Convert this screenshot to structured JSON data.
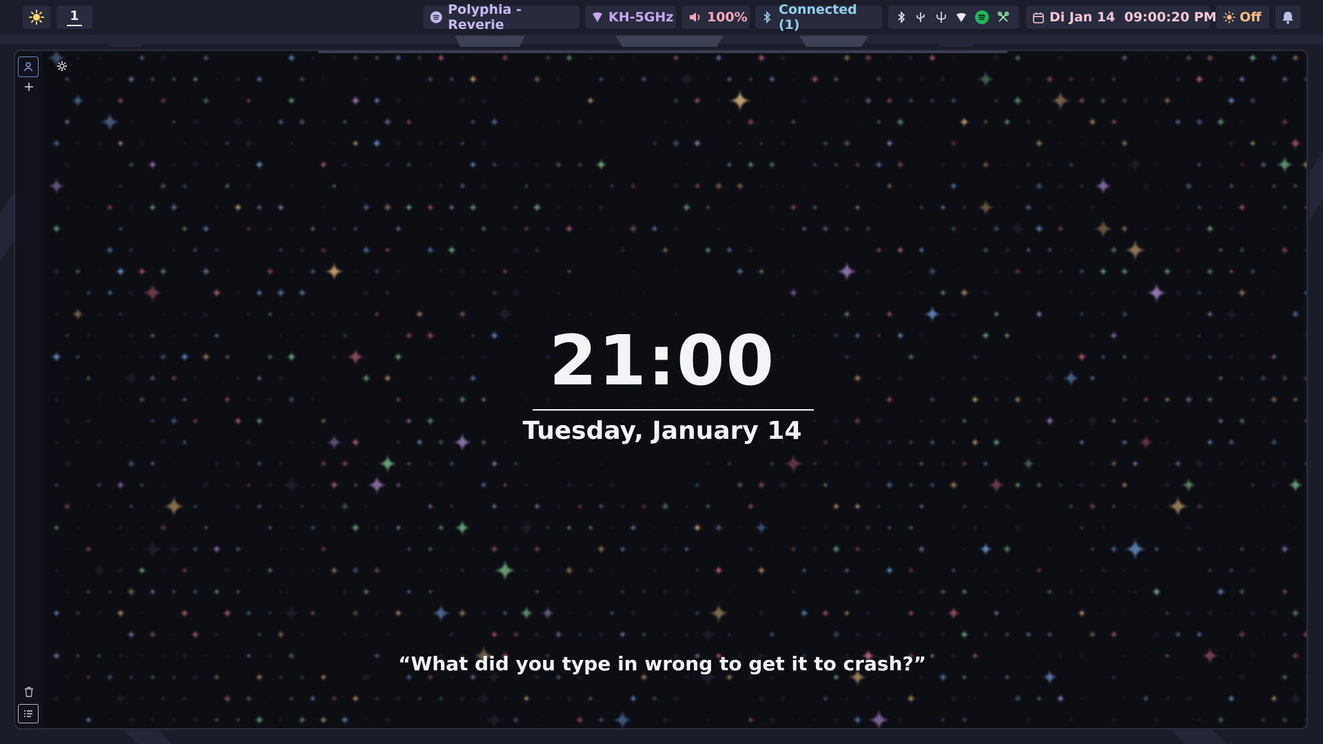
{
  "topbar": {
    "workspace": "1",
    "media": "Polyphia - Reverie",
    "wifi": "KH-5GHz",
    "volume": "100%",
    "bluetooth": "Connected (1)",
    "datetime": "Di Jan 14  09:00:20 PM",
    "night_light": "Off"
  },
  "lockscreen": {
    "time": "21:00",
    "date": "Tuesday, January 14",
    "quote": "“What did you type in wrong to get it to crash?”"
  },
  "colors": {
    "bar_bg": "#1b1d2a",
    "pill_bg": "#282b3d",
    "spotify": "#1db954",
    "volume_text": "#f5a8b8",
    "bluetooth_text": "#8fd0e8",
    "date_text": "#f2c7d3",
    "off_text": "#f7bb85"
  }
}
